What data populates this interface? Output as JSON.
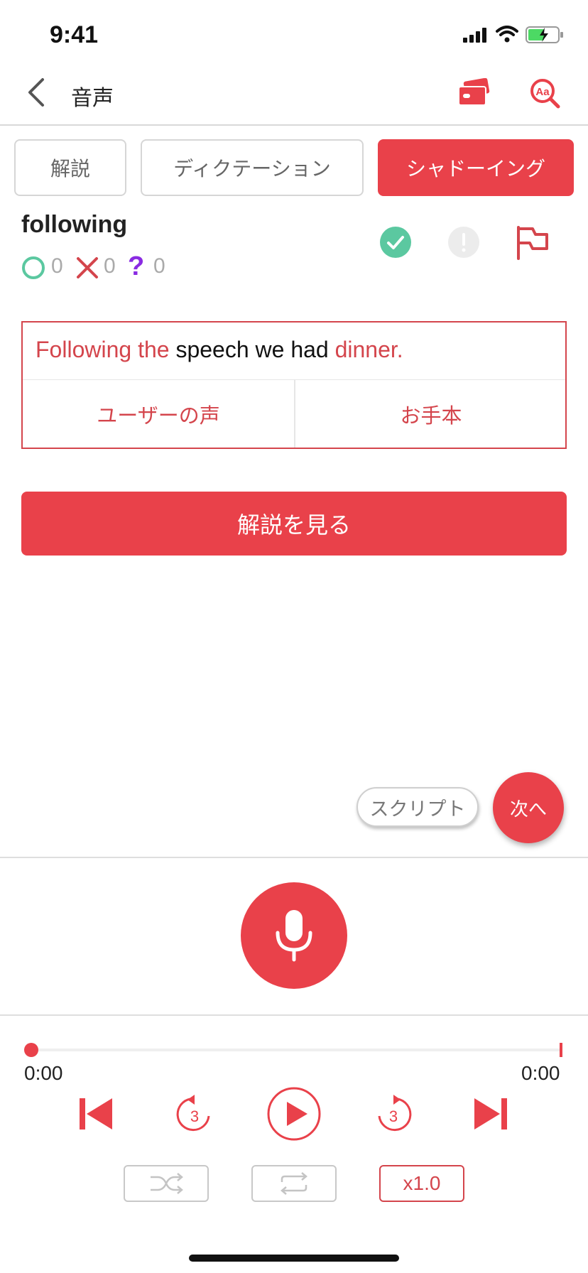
{
  "status_bar": {
    "time": "9:41"
  },
  "header": {
    "title": "音声"
  },
  "tabs": [
    {
      "label": "解説"
    },
    {
      "label": "ディクテーション"
    },
    {
      "label": "シャドーイング"
    }
  ],
  "word": {
    "text": "following",
    "stats": {
      "correct": "0",
      "wrong": "0",
      "unsure": "0"
    }
  },
  "sentence": {
    "parts": [
      "Following the",
      " speech we had ",
      "dinner."
    ],
    "user_voice_label": "ユーザーの声",
    "model_label": "お手本"
  },
  "explanation_button": "解説を見る",
  "script_button": "スクリプト",
  "next_button": "次へ",
  "player": {
    "current_time": "0:00",
    "total_time": "0:00",
    "progress": 0,
    "rewind_seconds": "3",
    "forward_seconds": "3",
    "speed": "x1.0"
  },
  "colors": {
    "accent": "#e9414a",
    "correct": "#5bc8a0",
    "wrong": "#d4454c",
    "unsure": "#8a2be2"
  }
}
